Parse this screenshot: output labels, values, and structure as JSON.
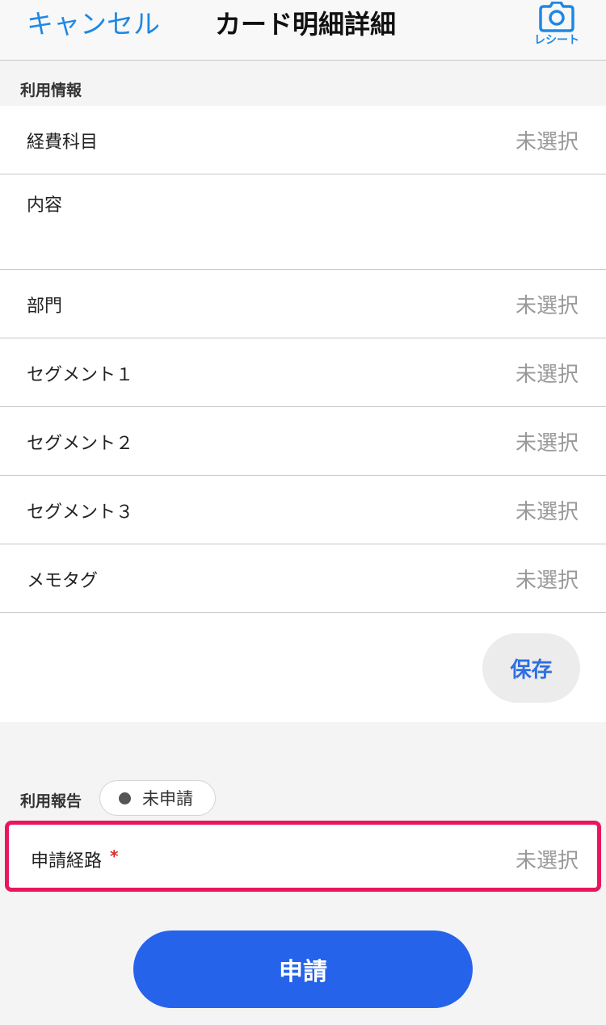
{
  "header": {
    "cancel_label": "キャンセル",
    "title": "カード明細詳細",
    "receipt_label": "レシート",
    "receipt_icon": "camera-icon"
  },
  "usage_info": {
    "section_label": "利用情報",
    "rows": [
      {
        "label": "経費科目",
        "value": "未選択"
      },
      {
        "label": "内容",
        "value": ""
      },
      {
        "label": "部門",
        "value": "未選択"
      },
      {
        "label": "セグメント１",
        "value": "未選択"
      },
      {
        "label": "セグメント２",
        "value": "未選択"
      },
      {
        "label": "セグメント３",
        "value": "未選択"
      },
      {
        "label": "メモタグ",
        "value": "未選択"
      }
    ],
    "save_label": "保存"
  },
  "usage_report": {
    "section_label": "利用報告",
    "status_text": "未申請",
    "route_label": "申請経路",
    "required_mark": "*",
    "route_value": "未選択"
  },
  "submit_label": "申請",
  "colors": {
    "accent": "#1e88e5",
    "primary_button": "#2563eb",
    "highlight_border": "#e8175d",
    "placeholder": "#999999"
  }
}
